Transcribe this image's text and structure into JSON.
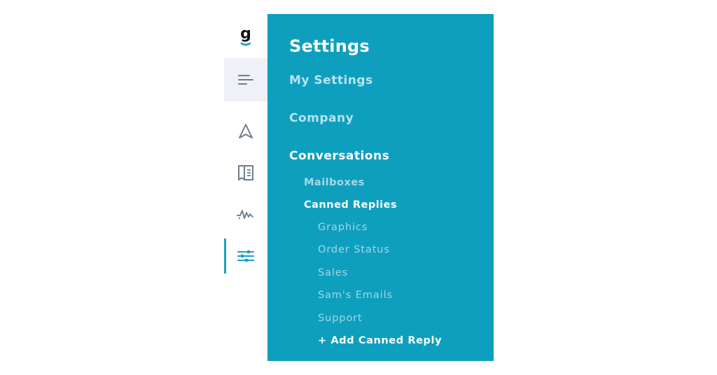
{
  "app": {
    "logo_letter": "g",
    "brand_color": "#0e9fbf",
    "rail_background": "#ffffff",
    "menu_button_background": "#eef1f5"
  },
  "rail": {
    "icons": [
      {
        "name": "hamburger-menu-icon"
      },
      {
        "name": "paper-plane-icon"
      },
      {
        "name": "book-icon"
      },
      {
        "name": "activity-pulse-icon"
      },
      {
        "name": "sliders-settings-icon",
        "active": true
      }
    ]
  },
  "settings": {
    "title": "Settings",
    "sections": {
      "my_settings": "My Settings",
      "company": "Company",
      "conversations": "Conversations"
    },
    "conversations": {
      "mailboxes": "Mailboxes",
      "canned_replies": "Canned Replies",
      "canned_reply_items": [
        "Graphics",
        "Order Status",
        "Sales",
        "Sam's Emails",
        "Support"
      ],
      "add_canned_reply": "+ Add Canned Reply"
    }
  }
}
